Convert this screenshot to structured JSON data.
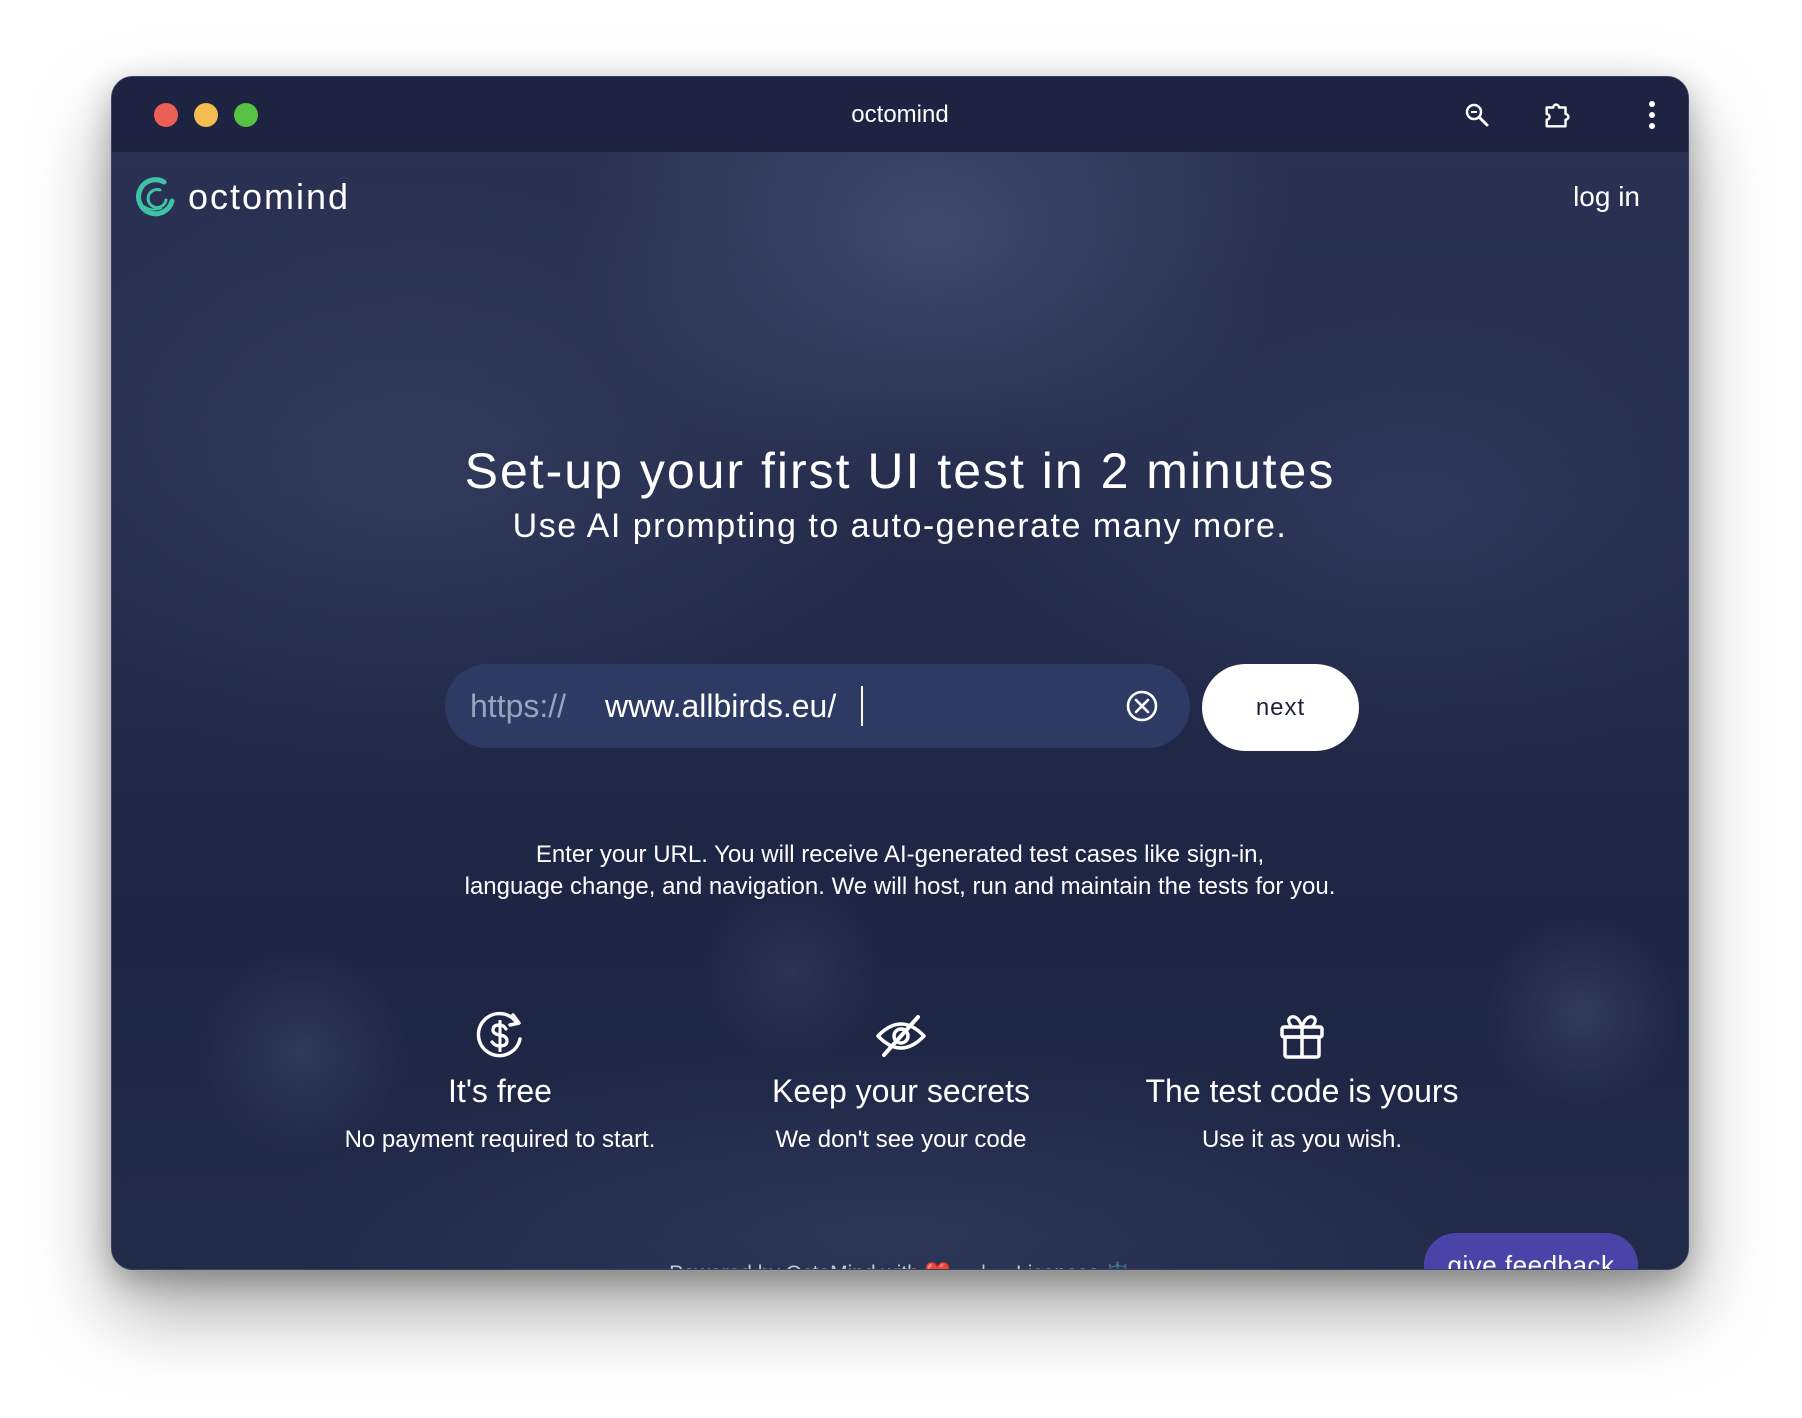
{
  "window": {
    "title": "octomind"
  },
  "header": {
    "brand_name": "octomind",
    "login_label": "log in"
  },
  "hero": {
    "headline": "Set-up your first UI test in 2 minutes",
    "subheadline": "Use AI prompting to auto-generate many more."
  },
  "url_form": {
    "prefix": "https://",
    "value": "www.allbirds.eu/",
    "next_label": "next"
  },
  "description": {
    "line1": "Enter your URL. You will receive AI-generated test cases like sign-in,",
    "line2": "language change, and navigation. We will host, run and maintain the tests for you."
  },
  "features": [
    {
      "icon": "dollar-cycle-icon",
      "title": "It's free",
      "subtitle": "No payment required to start."
    },
    {
      "icon": "eye-slash-icon",
      "title": "Keep your secrets",
      "subtitle": "We don't see your code"
    },
    {
      "icon": "gift-icon",
      "title": "The test code is yours",
      "subtitle": "Use it as you wish."
    }
  ],
  "footer": {
    "powered_text": "Powered by OctoMind with",
    "heart": "❤️",
    "separator": "|",
    "licenses_label": "Licenses",
    "licenses_icon": "⚖️"
  },
  "feedback": {
    "label": "give feedback"
  },
  "colors": {
    "background": "#1b2240",
    "url_box": "#2d3a63",
    "feedback_button": "#4a43a8",
    "brand_accent": "#3fc3a6"
  }
}
